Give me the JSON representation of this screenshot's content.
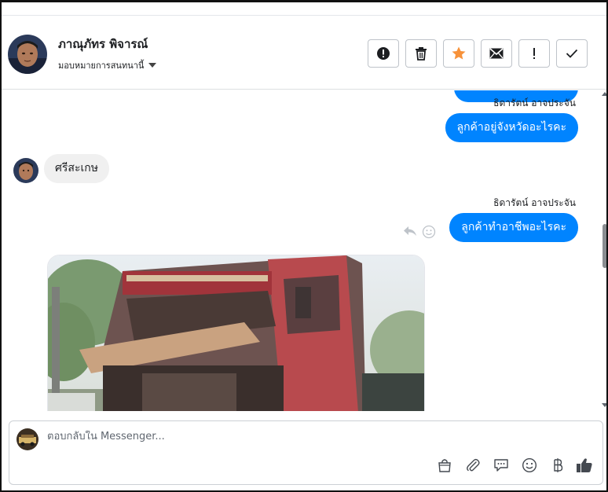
{
  "header": {
    "contact_name": "ภาณุภัทร พิจารณ์",
    "assign_label": "มอบหมายการสนทนานี้"
  },
  "conversation": {
    "messages": [
      {
        "direction": "out",
        "sender": "ธิดารัตน์ อาจประจัน",
        "text": "ลูกค้าอยู่จังหวัดอะไรคะ"
      },
      {
        "direction": "in",
        "text": "ศรีสะเกษ"
      },
      {
        "direction": "out",
        "sender": "ธิดารัตน์ อาจประจัน",
        "text": "ลูกค้าทำอาชีพอะไรคะ"
      },
      {
        "direction": "in",
        "type": "image"
      }
    ]
  },
  "composer": {
    "placeholder": "ตอบกลับใน Messenger..."
  },
  "colors": {
    "bubble_out": "#0084ff",
    "bubble_in": "#f0f0f0",
    "star": "#f7923a"
  },
  "icons": {
    "header_buttons": [
      "alert-circle-icon",
      "trash-icon",
      "star-icon",
      "envelope-icon",
      "exclamation-icon",
      "check-icon"
    ],
    "composer_tools": [
      "shopping-bag-icon",
      "paperclip-icon",
      "saved-reply-icon",
      "emoji-icon",
      "baht-icon",
      "thumbs-up-icon"
    ]
  }
}
